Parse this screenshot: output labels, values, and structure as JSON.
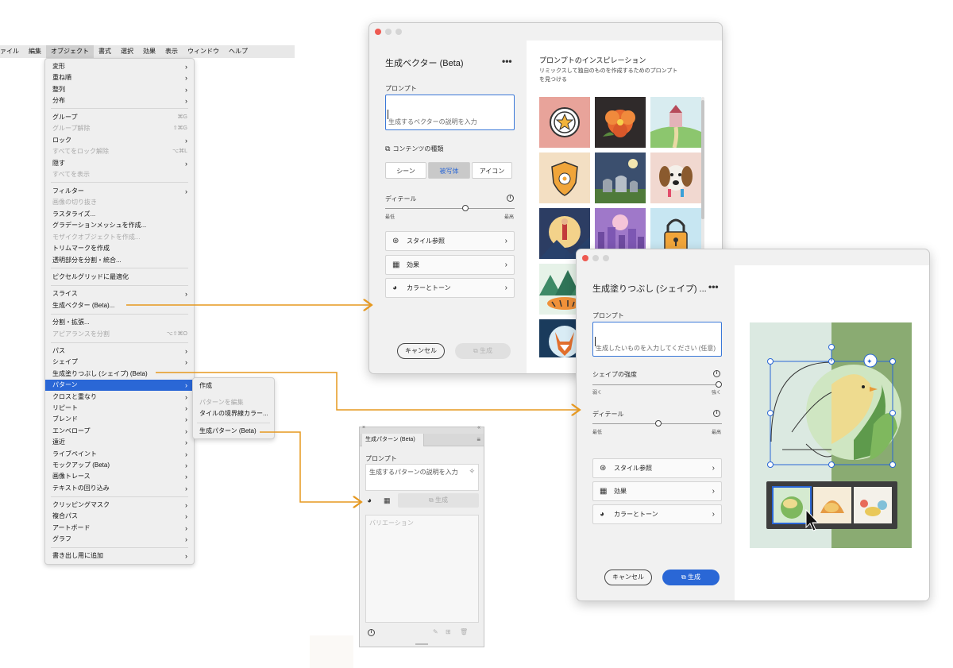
{
  "menubar": {
    "items": [
      "ァイル",
      "編集",
      "オブジェクト",
      "書式",
      "選択",
      "効果",
      "表示",
      "ウィンドウ",
      "ヘルプ"
    ],
    "active": "オブジェクト"
  },
  "dropdown": {
    "items": [
      {
        "label": "変形",
        "chev": "›"
      },
      {
        "label": "重ね順",
        "chev": "›"
      },
      {
        "label": "整列",
        "chev": "›"
      },
      {
        "label": "分布",
        "chev": "›"
      },
      {
        "label": "グループ",
        "shortcut": "⌘G"
      },
      {
        "label": "グループ解除",
        "shortcut": "⇧⌘G",
        "disabled": true
      },
      {
        "label": "ロック",
        "chev": "›"
      },
      {
        "label": "すべてをロック解除",
        "shortcut": "⌥⌘L",
        "disabled": true
      },
      {
        "label": "隠す",
        "chev": "›"
      },
      {
        "label": "すべてを表示",
        "disabled": true
      },
      {
        "label": "フィルター",
        "chev": "›"
      },
      {
        "label": "画像の切り抜き",
        "disabled": true
      },
      {
        "label": "ラスタライズ..."
      },
      {
        "label": "グラデーションメッシュを作成..."
      },
      {
        "label": "モザイクオブジェクトを作成...",
        "disabled": true
      },
      {
        "label": "トリムマークを作成"
      },
      {
        "label": "透明部分を分割・統合..."
      },
      {
        "label": "ピクセルグリッドに最適化"
      },
      {
        "label": "スライス",
        "chev": "›"
      },
      {
        "label": "生成ベクター (Beta)..."
      },
      {
        "label": "分割・拡張..."
      },
      {
        "label": "アピアランスを分割",
        "shortcut": "⌥⇧⌘O",
        "disabled": true
      },
      {
        "label": "パス",
        "chev": "›"
      },
      {
        "label": "シェイプ",
        "chev": "›"
      },
      {
        "label": "生成塗りつぶし (シェイプ) (Beta)"
      },
      {
        "label": "パターン",
        "chev": "›",
        "highlight": true
      },
      {
        "label": "クロスと重なり",
        "chev": "›"
      },
      {
        "label": "リピート",
        "chev": "›"
      },
      {
        "label": "ブレンド",
        "chev": "›"
      },
      {
        "label": "エンベロープ",
        "chev": "›"
      },
      {
        "label": "遠近",
        "chev": "›"
      },
      {
        "label": "ライブペイント",
        "chev": "›"
      },
      {
        "label": "モックアップ (Beta)",
        "chev": "›"
      },
      {
        "label": "画像トレース",
        "chev": "›"
      },
      {
        "label": "テキストの回り込み",
        "chev": "›"
      },
      {
        "label": "クリッピングマスク",
        "chev": "›"
      },
      {
        "label": "複合パス",
        "chev": "›"
      },
      {
        "label": "アートボード",
        "chev": "›"
      },
      {
        "label": "グラフ",
        "chev": "›"
      },
      {
        "label": "書き出し用に追加",
        "chev": "›"
      }
    ]
  },
  "submenu": {
    "items": [
      {
        "label": "作成"
      },
      {
        "label": "パターンを編集",
        "disabled": true
      },
      {
        "label": "タイルの境界線カラー..."
      },
      {
        "label": "生成パターン (Beta)"
      }
    ]
  },
  "vector_window": {
    "title": "生成ベクター (Beta)",
    "more": "•••",
    "prompt_label": "プロンプト",
    "prompt_placeholder": "生成するベクターの説明を入力",
    "content_type_label": "コンテンツの種類",
    "content_types": [
      "シーン",
      "被写体",
      "アイコン"
    ],
    "content_type_selected": "被写体",
    "detail_label": "ディテール",
    "detail_min": "最低",
    "detail_max": "最高",
    "detail_value": 0.62,
    "rows": [
      "スタイル参照",
      "効果",
      "カラーとトーン"
    ],
    "cancel": "キャンセル",
    "generate": "生成",
    "inspiration_title": "プロンプトのインスピレーション",
    "inspiration_sub1": "リミックスして独自のものを作成するためのプロンプト",
    "inspiration_sub2": "を見つける",
    "thumb_colors": [
      "#e8a39a",
      "#2f2a2a",
      "#d8ecf0",
      "#f3dfc3",
      "#3b4f6e",
      "#f1d8d0",
      "#2c3d63",
      "#c8a7d8",
      "#c7e6f2",
      "#6fa0a0",
      "#1a3b5c"
    ]
  },
  "shape_window": {
    "title": "生成塗りつぶし (シェイプ) ...",
    "more": "•••",
    "prompt_label": "プロンプト",
    "prompt_placeholder": "生成したいものを入力してください (任意)",
    "shape_strength_label": "シェイプの強度",
    "shape_min": "弱く",
    "shape_max": "強く",
    "shape_value": 1.0,
    "detail_label": "ディテール",
    "detail_min": "最低",
    "detail_max": "最高",
    "detail_value": 0.51,
    "rows": [
      "スタイル参照",
      "効果",
      "カラーとトーン"
    ],
    "cancel": "キャンセル",
    "generate": "生成"
  },
  "pattern_panel": {
    "tab_title": "生成パターン (Beta)",
    "prompt_label": "プロンプト",
    "prompt_placeholder": "生成するパターンの説明を入力",
    "generate": "生成",
    "variations_label": "バリエーション"
  },
  "colors": {
    "accent": "#2a67d6",
    "arrow": "#e6981f",
    "menu_bg": "#efefef"
  }
}
